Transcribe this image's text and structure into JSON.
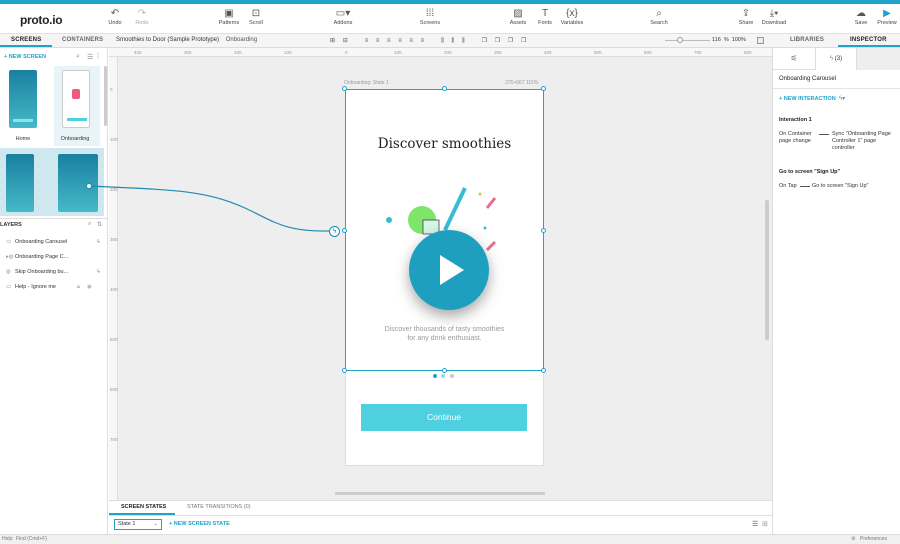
{
  "app": {
    "logo": "proto.io"
  },
  "toolbar": {
    "undo": "Undo",
    "redo": "Redo",
    "patterns": "Patterns",
    "scroll": "Scroll",
    "addons": "Addons",
    "screens": "Screens",
    "assets": "Assets",
    "fonts": "Fonts",
    "variables": "Variables",
    "search": "Search",
    "share": "Share",
    "download": "Download",
    "save": "Save",
    "preview": "Preview"
  },
  "left_tabs": {
    "screens": "SCREENS",
    "containers": "CONTAINERS"
  },
  "new_screen": "+ NEW SCREEN",
  "screens": [
    {
      "label": "Home"
    },
    {
      "label": "Onboarding"
    }
  ],
  "layers": {
    "title": "LAYERS",
    "items": [
      {
        "label": "Onboarding Carousel"
      },
      {
        "label": "Onboarding Page C..."
      },
      {
        "label": "Skip Onboarding bu..."
      },
      {
        "label": "Help - Ignore me"
      }
    ]
  },
  "breadcrumb": {
    "project": "Smoothies to Door (Sample Prototype)",
    "screen": "Onboarding"
  },
  "zoom": {
    "value": "116",
    "unit": "%",
    "fit": "100%"
  },
  "ruler_top": [
    "400",
    "300",
    "200",
    "100",
    "0",
    "100",
    "200",
    "300",
    "400",
    "500",
    "600",
    "700",
    "800",
    "900"
  ],
  "ruler_left": [
    "0",
    "100",
    "200",
    "300",
    "400",
    "500",
    "600",
    "700"
  ],
  "device": {
    "header_left": "Onboarding: State 1",
    "header_right": "375×667   115%",
    "title": "Discover smoothies",
    "body_line1": "Discover thousands of tasty smoothies",
    "body_line2": "for any drink enthusiast.",
    "continue": "Continue"
  },
  "right_tabs": {
    "libraries": "LIBRARIES",
    "inspector": "INSPECTOR",
    "bolt_count": "(3)"
  },
  "inspector": {
    "element": "Onboarding Carousel",
    "new_interaction": "+ NEW INTERACTION",
    "interaction1": {
      "title": "Interaction 1",
      "trigger": "On Container page change",
      "action": "Sync \"Onboarding Page Controller 1\" page controller"
    },
    "interaction2": {
      "title": "Go to screen \"Sign Up\"",
      "trigger": "On Tap",
      "action": "Go to screen \"Sign Up\""
    }
  },
  "bottom": {
    "screen_states": "SCREEN STATES",
    "state_transitions": "STATE TRANSITIONS (0)",
    "state_select": "State 1",
    "new_state": "+ NEW SCREEN STATE"
  },
  "status": {
    "help": "Help:",
    "find": "Find (Cmd+F)",
    "preferences": "Preferences"
  },
  "colors": {
    "accent": "#1fa3c8",
    "teal": "#3fb8d0",
    "continue": "#4fd0e0",
    "play": "#1e9fbf"
  }
}
